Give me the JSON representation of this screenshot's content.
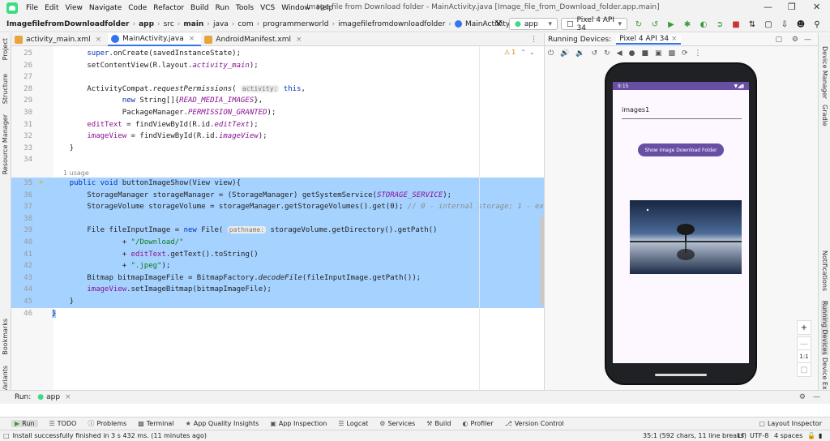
{
  "menu": {
    "items": [
      "File",
      "Edit",
      "View",
      "Navigate",
      "Code",
      "Refactor",
      "Build",
      "Run",
      "Tools",
      "VCS",
      "Window",
      "Help"
    ],
    "title": "Image file from Download folder - MainActivity.java [Image_file_from_Download_folder.app.main]"
  },
  "nav": {
    "crumbs": [
      "ImagefilefromDownloadfolder",
      "app",
      "src",
      "main",
      "java",
      "com",
      "programmerworld",
      "imagefilefromdownloadfolder",
      "MainActivity"
    ],
    "run_config": "app",
    "device": "Pixel 4 API 34"
  },
  "left_tools": [
    "Project",
    "Structure",
    "Resource Manager",
    "Bookmarks",
    "Build Variants"
  ],
  "right_tools": [
    "Device Manager",
    "Gradle",
    "Notifications",
    "Running Devices",
    "Device Explorer"
  ],
  "tabs": [
    {
      "label": "activity_main.xml",
      "color": "#e8a33d"
    },
    {
      "label": "MainActivity.java",
      "color": "#3574f0"
    },
    {
      "label": "AndroidManifest.xml",
      "color": "#e8a33d"
    }
  ],
  "editor": {
    "warnings": "1",
    "usage": "1 usage"
  },
  "code": {
    "l25": "25",
    "l26": "26",
    "l27": "27",
    "l28": "28",
    "l29": "29",
    "l30": "30",
    "l31": "31",
    "l32": "32",
    "l33": "33",
    "l34": "34",
    "l35": "35",
    "l36": "36",
    "l37": "37",
    "l38": "38",
    "l39": "39",
    "l40": "40",
    "l41": "41",
    "l42": "42",
    "l43": "43",
    "l44": "44",
    "l45": "45",
    "l46": "46"
  },
  "running": {
    "title": "Running Devices:",
    "device_tab": "Pixel 4 API 34"
  },
  "phone": {
    "time": "9:15",
    "input_text": "images1",
    "button_label": "Show Image Download Folder",
    "zoom_label": "1:1"
  },
  "run": {
    "label": "Run:",
    "config": "app"
  },
  "bottom_tools": [
    "Run",
    "TODO",
    "Problems",
    "Terminal",
    "App Quality Insights",
    "App Inspection",
    "Logcat",
    "Services",
    "Build",
    "Profiler",
    "Version Control"
  ],
  "layout_inspector": "Layout Inspector",
  "status": {
    "message": "Install successfully finished in 3 s 432 ms. (11 minutes ago)",
    "position": "35:1 (592 chars, 11 line breaks)",
    "line_sep": "LF",
    "encoding": "UTF-8",
    "indent": "4 spaces"
  }
}
